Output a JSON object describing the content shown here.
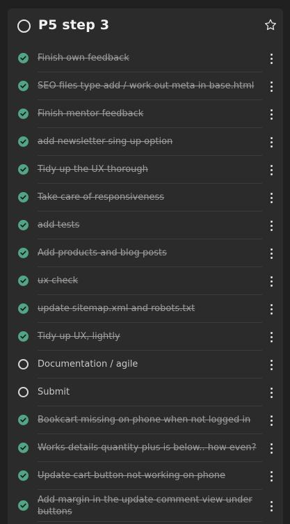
{
  "list": {
    "title": "P5 step 3",
    "icons": {
      "title_status": "circle-outline-icon",
      "favorite": "star-outline-icon",
      "completed": "check-circle-icon",
      "pending": "circle-outline-icon",
      "more": "more-vertical-icon"
    },
    "colors": {
      "completed": "#4fa584",
      "background": "#2b2b2b"
    }
  },
  "tasks": [
    {
      "label": "Finish own feedback",
      "done": true
    },
    {
      "label": "SEO files type add / work out meta in base.html",
      "done": true
    },
    {
      "label": "Finish mentor feedback",
      "done": true
    },
    {
      "label": "add newsletter sing up option",
      "done": true
    },
    {
      "label": "Tidy up the UX thorough",
      "done": true
    },
    {
      "label": "Take care of responsiveness",
      "done": true
    },
    {
      "label": "add tests",
      "done": true
    },
    {
      "label": "Add products and blog posts",
      "done": true
    },
    {
      "label": "ux check",
      "done": true
    },
    {
      "label": "update sitemap.xml and robots.txt",
      "done": true
    },
    {
      "label": "Tidy up UX, lightly",
      "done": true
    },
    {
      "label": "Documentation / agile",
      "done": false
    },
    {
      "label": "Submit",
      "done": false
    },
    {
      "label": "Bookcart missing on phone when not logged in",
      "done": true
    },
    {
      "label": "Works details quantity plus is below.. how even?",
      "done": true
    },
    {
      "label": "Update cart button not working on phone",
      "done": true
    },
    {
      "label": "Add margin in the update comment view under buttons",
      "done": true
    }
  ]
}
